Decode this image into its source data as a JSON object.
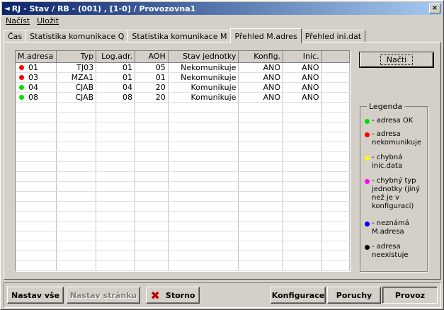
{
  "window": {
    "title": "RJ - Stav / RB - (001) , [1-0] / Provozovna1",
    "close_label": "×"
  },
  "menu": {
    "items": [
      "Načíst",
      "Uložit"
    ]
  },
  "tabs": [
    {
      "label": "Čas",
      "active": false
    },
    {
      "label": "Statistika komunikace Q",
      "active": false
    },
    {
      "label": "Statistika komunikace M",
      "active": false
    },
    {
      "label": "Přehled M.adres",
      "active": true
    },
    {
      "label": "Přehled ini.dat",
      "active": false
    }
  ],
  "table": {
    "columns": [
      "M.adresa",
      "Typ",
      "Log.adr.",
      "AOH",
      "Stav jednotky",
      "Konfig.",
      "Inic."
    ],
    "rows": [
      {
        "status_color": "#ff0000",
        "cells": [
          "01",
          "TJ03",
          "01",
          "05",
          "Nekomunikuje",
          "ANO",
          "ANO"
        ]
      },
      {
        "status_color": "#ff0000",
        "cells": [
          "03",
          "MZA1",
          "01",
          "01",
          "Nekomunikuje",
          "ANO",
          "ANO"
        ]
      },
      {
        "status_color": "#00e000",
        "cells": [
          "04",
          "CJAB",
          "04",
          "20",
          "Komunikuje",
          "ANO",
          "ANO"
        ]
      },
      {
        "status_color": "#00e000",
        "cells": [
          "08",
          "CJAB",
          "08",
          "20",
          "Komunikuje",
          "ANO",
          "ANO"
        ]
      }
    ],
    "empty_rows": 17
  },
  "load_button": {
    "label": "Načti"
  },
  "legend": {
    "title": "Legenda",
    "items": [
      {
        "color": "#00e000",
        "text": "- adresa OK"
      },
      {
        "color": "#ff0000",
        "text": "- adresa nekomunikuje"
      },
      {
        "color": "#ffff00",
        "text": "- chybná inic.data"
      },
      {
        "color": "#ff00ff",
        "text": "- chybný typ jednotky (jiný než je v konfiguraci)"
      },
      {
        "color": "#0000ff",
        "text": "- neznámá M.adresa"
      },
      {
        "color": "#000000",
        "text": "- adresa neexistuje"
      }
    ]
  },
  "bottom": {
    "set_all": "Nastav vše",
    "set_page": "Nastav stránku",
    "cancel": "Storno",
    "cancel_icon": "x-icon",
    "config": "Konfigurace",
    "faults": "Poruchy",
    "operation": "Provoz"
  }
}
